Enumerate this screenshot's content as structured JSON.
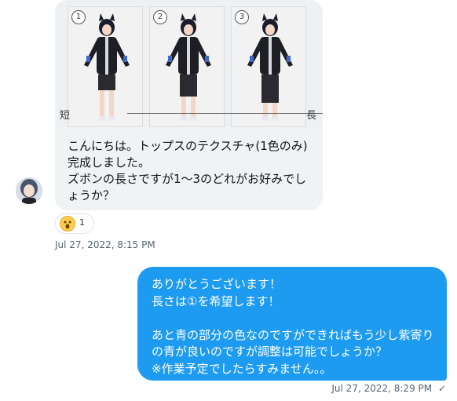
{
  "incoming": {
    "image": {
      "panel_numbers": [
        "1",
        "2",
        "3"
      ],
      "left_label": "短",
      "right_label": "長"
    },
    "text_lines": [
      "こんにちは。トップスのテクスチャ(1色のみ)",
      "完成しました。",
      "ズボンの長さですが1〜3のどれがお好みでし",
      "ょうか？"
    ],
    "reaction": {
      "emoji": "surprised-face-icon",
      "count": "1"
    },
    "timestamp": "Jul 27, 2022, 8:15 PM"
  },
  "outgoing": {
    "text_lines": [
      "ありがとうございます！",
      "長さは①を希望します！",
      "",
      "あと青の部分の色なのですができればもう少し紫寄り",
      "の青が良いのですが調整は可能でしょうか？",
      "※作業予定でしたらすみません。。"
    ],
    "timestamp": "Jul 27, 2022, 8:29 PM",
    "status": "✓"
  },
  "colors": {
    "outgoing_bubble": "#1d9bf0",
    "incoming_bubble": "#eff3f4",
    "timestamp": "#536471"
  }
}
